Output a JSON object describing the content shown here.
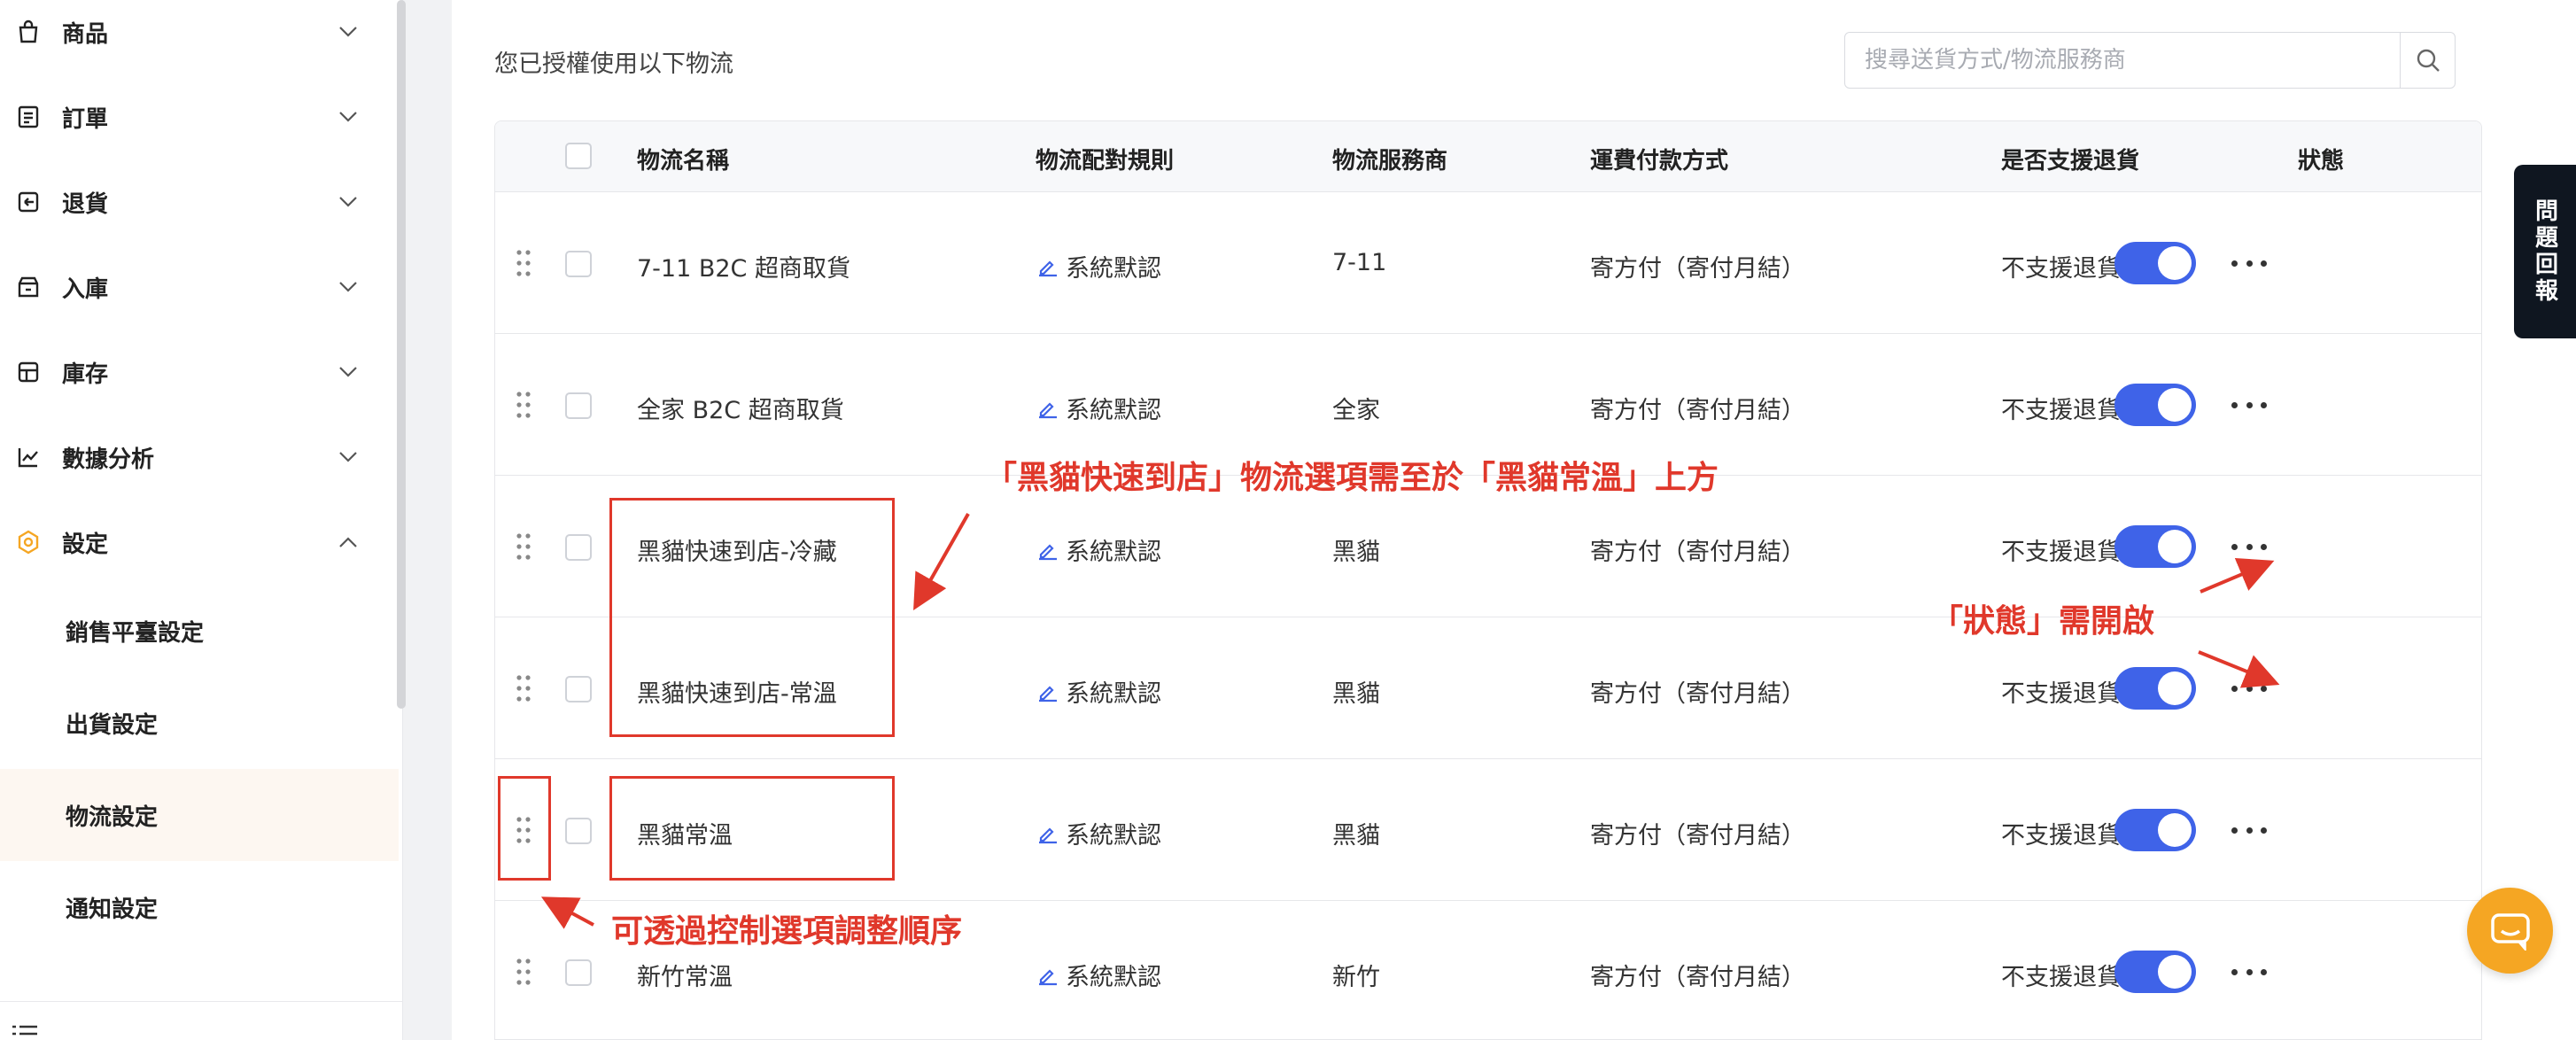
{
  "sidebar": {
    "menu": [
      {
        "label": "商品",
        "icon": "bag-icon",
        "expanded": false
      },
      {
        "label": "訂單",
        "icon": "order-list-icon",
        "expanded": false
      },
      {
        "label": "退貨",
        "icon": "return-icon",
        "expanded": false
      },
      {
        "label": "入庫",
        "icon": "inbound-icon",
        "expanded": false
      },
      {
        "label": "庫存",
        "icon": "inventory-icon",
        "expanded": false
      },
      {
        "label": "數據分析",
        "icon": "analytics-icon",
        "expanded": false
      },
      {
        "label": "設定",
        "icon": "settings-hex-icon",
        "expanded": true
      }
    ],
    "submenu": [
      {
        "label": "銷售平臺設定",
        "active": false
      },
      {
        "label": "出貨設定",
        "active": false
      },
      {
        "label": "物流設定",
        "active": true
      },
      {
        "label": "通知設定",
        "active": false
      }
    ]
  },
  "main": {
    "intro": "您已授權使用以下物流",
    "search": {
      "placeholder": "搜尋送貨方式/物流服務商",
      "value": ""
    },
    "columns": {
      "name": "物流名稱",
      "rule": "物流配對規則",
      "provider": "物流服務商",
      "payment": "運費付款方式",
      "returns": "是否支援退貨",
      "status": "狀態"
    },
    "rows": [
      {
        "name": "7-11 B2C 超商取貨",
        "rule": "系統默認",
        "provider": "7-11",
        "payment": "寄方付（寄付月結）",
        "returns": "不支援退貨",
        "enabled": true
      },
      {
        "name": "全家 B2C 超商取貨",
        "rule": "系統默認",
        "provider": "全家",
        "payment": "寄方付（寄付月結）",
        "returns": "不支援退貨",
        "enabled": true
      },
      {
        "name": "黑貓快速到店-冷藏",
        "rule": "系統默認",
        "provider": "黑貓",
        "payment": "寄方付（寄付月結）",
        "returns": "不支援退貨",
        "enabled": true
      },
      {
        "name": "黑貓快速到店-常溫",
        "rule": "系統默認",
        "provider": "黑貓",
        "payment": "寄方付（寄付月結）",
        "returns": "不支援退貨",
        "enabled": true
      },
      {
        "name": "黑貓常溫",
        "rule": "系統默認",
        "provider": "黑貓",
        "payment": "寄方付（寄付月結）",
        "returns": "不支援退貨",
        "enabled": true
      },
      {
        "name": "新竹常溫",
        "rule": "系統默認",
        "provider": "新竹",
        "payment": "寄方付（寄付月結）",
        "returns": "不支援退貨",
        "enabled": true
      }
    ]
  },
  "annotations": {
    "order_note": "「黑貓快速到店」物流選項需至於「黑貓常溫」上方",
    "status_note": "「狀態」需開啟",
    "drag_note": "可透過控制選項調整順序"
  },
  "widgets": {
    "feedback": "問題回報"
  },
  "colors": {
    "accent": "#3f63e8",
    "annotation": "#e0382b",
    "active_bg": "#fdf7f1",
    "settings_icon": "#f5a623",
    "chat": "#f5a623"
  }
}
